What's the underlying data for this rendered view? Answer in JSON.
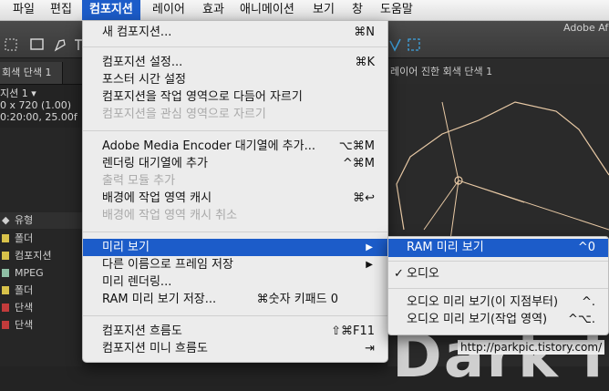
{
  "menubar": {
    "items": [
      "파일",
      "편집",
      "컴포지션",
      "레이어",
      "효과",
      "애니메이션",
      "보기",
      "창",
      "도움말"
    ]
  },
  "app": {
    "title_fragment": "Adobe Af"
  },
  "tabs": {
    "left": "회색 단색 1",
    "right": "레이어 진한 회색 단색 1"
  },
  "comp_info": {
    "line1": "지션 1 ▾",
    "line2": "0 x 720 (1.00)",
    "line3": "0:20:00, 25.00f"
  },
  "layers": {
    "header": "유형",
    "rows": [
      {
        "label": "폴더",
        "color": "#d8c24a"
      },
      {
        "label": "컴포지션",
        "color": "#d8c24a"
      },
      {
        "label": "MPEG",
        "color": "#8fbfa5"
      },
      {
        "label": "폴더",
        "color": "#d8c24a"
      },
      {
        "label": "단색",
        "color": "#c23b3b"
      },
      {
        "label": "단색",
        "color": "#c23b3b"
      }
    ]
  },
  "composition_menu": {
    "items": [
      {
        "label": "새 컴포지션...",
        "shortcut": "⌘N"
      },
      {
        "label": "컴포지션 설정...",
        "shortcut": "⌘K"
      },
      {
        "label": "포스터 시간 설정",
        "shortcut": ""
      },
      {
        "label": "컴포지션을 작업 영역으로 다듬어 자르기",
        "shortcut": ""
      },
      {
        "label": "컴포지션을 관심 영역으로 자르기",
        "shortcut": ""
      },
      {
        "label": "Adobe Media Encoder 대기열에 추가...",
        "shortcut": "⌥⌘M"
      },
      {
        "label": "렌더링 대기열에 추가",
        "shortcut": "^⌘M"
      },
      {
        "label": "출력 모듈 추가",
        "shortcut": ""
      },
      {
        "label": "배경에 작업 영역 캐시",
        "shortcut": "⌘↩"
      },
      {
        "label": "배경에 작업 영역 캐시 취소",
        "shortcut": ""
      },
      {
        "label": "미리 보기",
        "shortcut": "▶"
      },
      {
        "label": "다른 이름으로 프레임 저장",
        "shortcut": "▶"
      },
      {
        "label": "미리 렌더링...",
        "shortcut": ""
      },
      {
        "label": "RAM 미리 보기 저장...",
        "shortcut": "⌘숫자 키패드 0"
      },
      {
        "label": "컴포지션 흐름도",
        "shortcut": "⇧⌘F11"
      },
      {
        "label": "컴포지션 미니 흐름도",
        "shortcut": "⇥"
      }
    ]
  },
  "preview_submenu": {
    "items": [
      {
        "label": "RAM 미리 보기",
        "shortcut": "^0"
      },
      {
        "label": "오디오",
        "shortcut": "",
        "check": "✓"
      },
      {
        "label": "오디오 미리 보기(이 지점부터)",
        "shortcut": "^."
      },
      {
        "label": "오디오 미리 보기(작업 영역)",
        "shortcut": "^⌥."
      }
    ]
  },
  "viewer": {
    "big_text": "Dark l"
  },
  "watermark": "http://parkpic.tistory.com/",
  "colors": {
    "highlight": "#1c5cc9",
    "menu_bg": "#ececec",
    "ae_bg": "#232323",
    "shape_line": "#e8c9a5"
  }
}
